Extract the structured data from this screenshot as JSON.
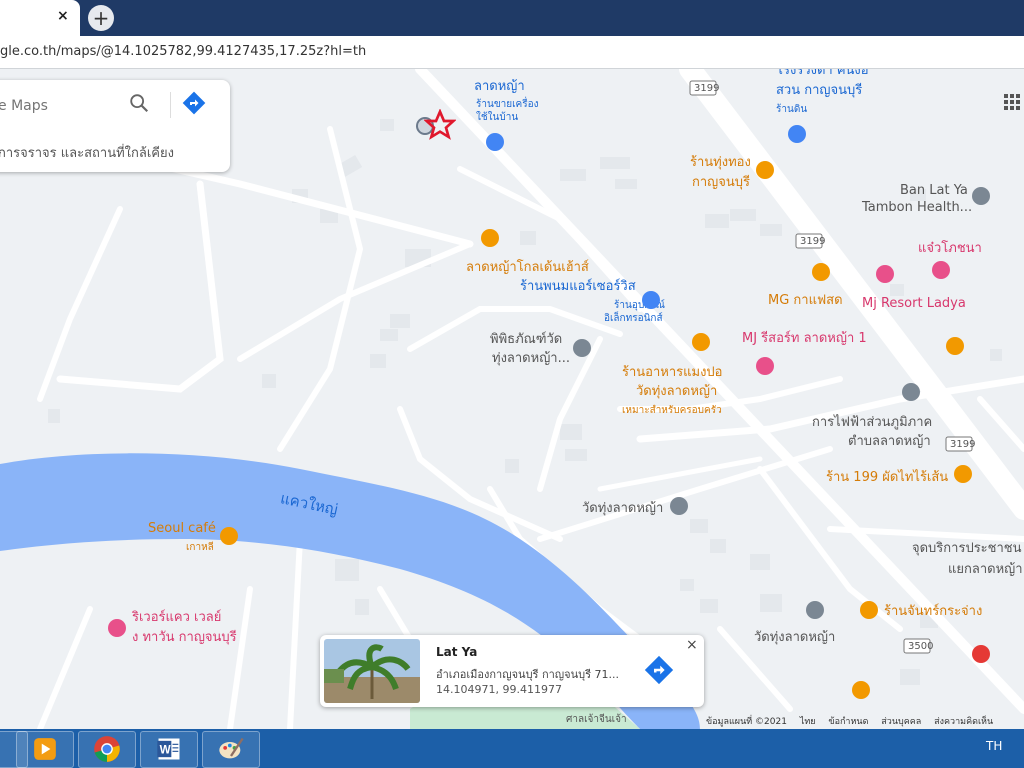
{
  "browser": {
    "tab_close": "×",
    "new_tab": "+",
    "url": "gle.co.th/maps/@14.1025782,99.4127435,17.25z?hl=th"
  },
  "search": {
    "placeholder": "e Maps",
    "subtitle": "การจราจร และสถานที่ใกล้เคียง"
  },
  "places": {
    "lat_ya": "ลาดหญ้า",
    "shop_appliance_1": "ร้านขายเครื่อง",
    "shop_appliance_2": "ใช้ในบ้าน",
    "top_right_1": "โรงรวิงตา คนงอ",
    "top_right_2": "สวน กาญจนบุรี",
    "top_right_shop": "ร้านดิน",
    "thung_thong_1": "ร้านทุ่งทอง",
    "thung_thong_2": "กาญจนบุรี",
    "ban_lat_ya_1": "Ban Lat Ya",
    "ban_lat_ya_2": "Tambon Health...",
    "golden_house": "ลาดหญ้าโกลเด้นเฮ้าส์",
    "phanom": "ร้านพนมแอร์เซอร์วิส",
    "electronics_1": "ร้านอุปกรณ์",
    "electronics_2": "อิเล็กทรอนิกส์",
    "jaeo": "แจ๋วโภชนา",
    "mg_coffee": "MG กาแฟสด",
    "mj_ladya": "Mj Resort Ladya",
    "museum_1": "พิพิธภัณฑ์วัด",
    "museum_2": "ทุ่งลาดหญ้า...",
    "mj_resort": "MJ รีสอร์ท ลาดหญ้า 1",
    "restaurant_1": "ร้านอาหารแมงปอ",
    "restaurant_2": "วัดทุ่งลาดหญ้า",
    "restaurant_3": "เหมาะสำหรับครอบครัว",
    "pea_1": "การไฟฟ้าส่วนภูมิภาค",
    "pea_2": "ตำบลลาดหญ้า",
    "pad_thai": "ร้าน 199 ผัดไทไร้เส้น",
    "river": "แควใหญ่",
    "wat_1": "วัดทุ่งลาดหญ้า",
    "seoul_cafe": "Seoul café",
    "seoul_sub": "เกาหลี",
    "service_1": "จุดบริการประชาชน",
    "service_2": "แยกลาดหญ้า",
    "riverkwae_1": "ริเวอร์แคว เวลย์",
    "riverkwae_2": "ง ทาวัน กาญจนบุรี",
    "chan_krachang": "ร้านจันทร์กระจ่าง",
    "wat_2": "วัดทุ่งลาดหญ้า",
    "shrine": "ศาลเจ้าจีนเจ้า",
    "road_3199_a": "3199",
    "road_3199_b": "3199",
    "road_3199_c": "3199",
    "road_3500": "3500"
  },
  "card": {
    "title": "Lat Ya",
    "address": "อำเภอเมืองกาญจนบุรี กาญจนบุรี 71...",
    "coords": "14.104971, 99.411977",
    "close": "×"
  },
  "footer": {
    "map_data": "ข้อมูลแผนที่ ©2021",
    "thai": "ไทย",
    "terms": "ข้อกำหนด",
    "privacy": "ส่วนบุคคล",
    "feedback": "ส่งความคิดเห็น"
  },
  "taskbar": {
    "lang": "TH"
  },
  "colors": {
    "river": "#8ab4f8",
    "road": "#ffffff",
    "taskbar": "#1c5fa8",
    "tabbar": "#1f3a66"
  }
}
